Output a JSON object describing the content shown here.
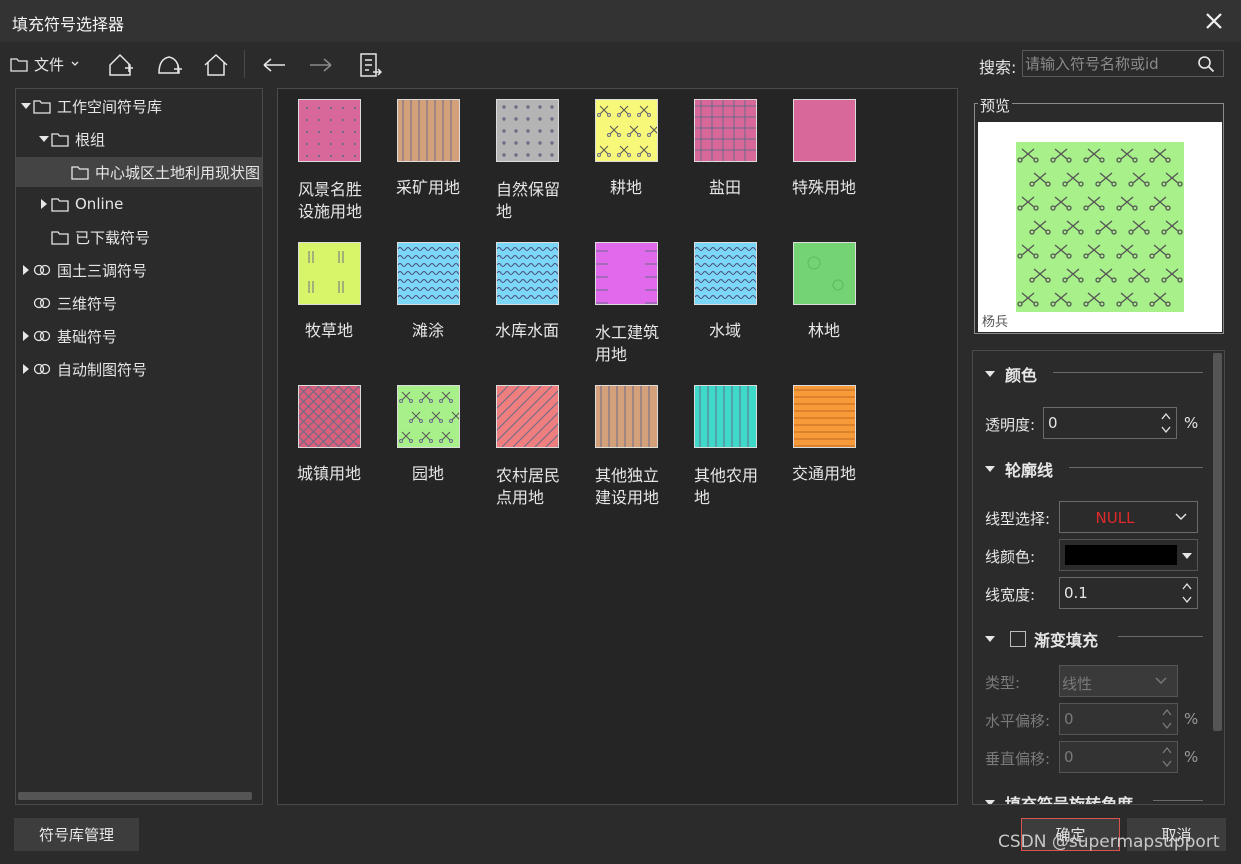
{
  "window": {
    "title": "填充符号选择器"
  },
  "toolbar": {
    "file_label": "文件",
    "search_label": "搜索:",
    "search_placeholder": "请输入符号名称或id"
  },
  "tree": {
    "items": [
      {
        "label": "工作空间符号库"
      },
      {
        "label": "根组"
      },
      {
        "label": "中心城区土地利用现状图"
      },
      {
        "label": "Online"
      },
      {
        "label": "已下载符号"
      },
      {
        "label": "国土三调符号"
      },
      {
        "label": "三维符号"
      },
      {
        "label": "基础符号"
      },
      {
        "label": "自动制图符号"
      }
    ]
  },
  "symbols": [
    {
      "label": "风景名胜设施用地",
      "color": "#d9689a"
    },
    {
      "label": "采矿用地",
      "color": "#d4a07a"
    },
    {
      "label": "自然保留地",
      "color": "#b4b4b4"
    },
    {
      "label": "耕地",
      "color": "#f7f77a"
    },
    {
      "label": "盐田",
      "color": "#d9689a"
    },
    {
      "label": "特殊用地",
      "color": "#d9689a"
    },
    {
      "label": "牧草地",
      "color": "#d8f56a"
    },
    {
      "label": "滩涂",
      "color": "#7bd7f5"
    },
    {
      "label": "水库水面",
      "color": "#7bd7f5"
    },
    {
      "label": "水工建筑用地",
      "color": "#e06aeb"
    },
    {
      "label": "水域",
      "color": "#7bd7f5"
    },
    {
      "label": "林地",
      "color": "#74d474"
    },
    {
      "label": "城镇用地",
      "color": "#d9607a"
    },
    {
      "label": "园地",
      "color": "#a8f08a"
    },
    {
      "label": "农村居民点用地",
      "color": "#ef7e7e"
    },
    {
      "label": "其他独立建设用地",
      "color": "#d4a07a"
    },
    {
      "label": "其他农用地",
      "color": "#3ed9c8"
    },
    {
      "label": "交通用地",
      "color": "#f79a3a"
    }
  ],
  "preview": {
    "title": "预览",
    "caption": "杨兵",
    "color": "#a8f08a"
  },
  "properties": {
    "color_section": "颜色",
    "transparency_label": "透明度:",
    "transparency_value": "0",
    "percent": "%",
    "outline_section": "轮廓线",
    "line_type_label": "线型选择:",
    "line_type_value": "NULL",
    "line_color_label": "线颜色:",
    "line_color_value": "#000000",
    "line_width_label": "线宽度:",
    "line_width_value": "0.1",
    "gradient_section": "渐变填充",
    "gradient_type_label": "类型:",
    "gradient_type_value": "线性",
    "h_offset_label": "水平偏移:",
    "h_offset_value": "0",
    "v_offset_label": "垂直偏移:",
    "v_offset_value": "0",
    "rotation_section": "填充符号旋转角度"
  },
  "buttons": {
    "manage": "符号库管理",
    "ok": "确定",
    "cancel": "取消"
  },
  "watermark": "CSDN @supermapsupport"
}
